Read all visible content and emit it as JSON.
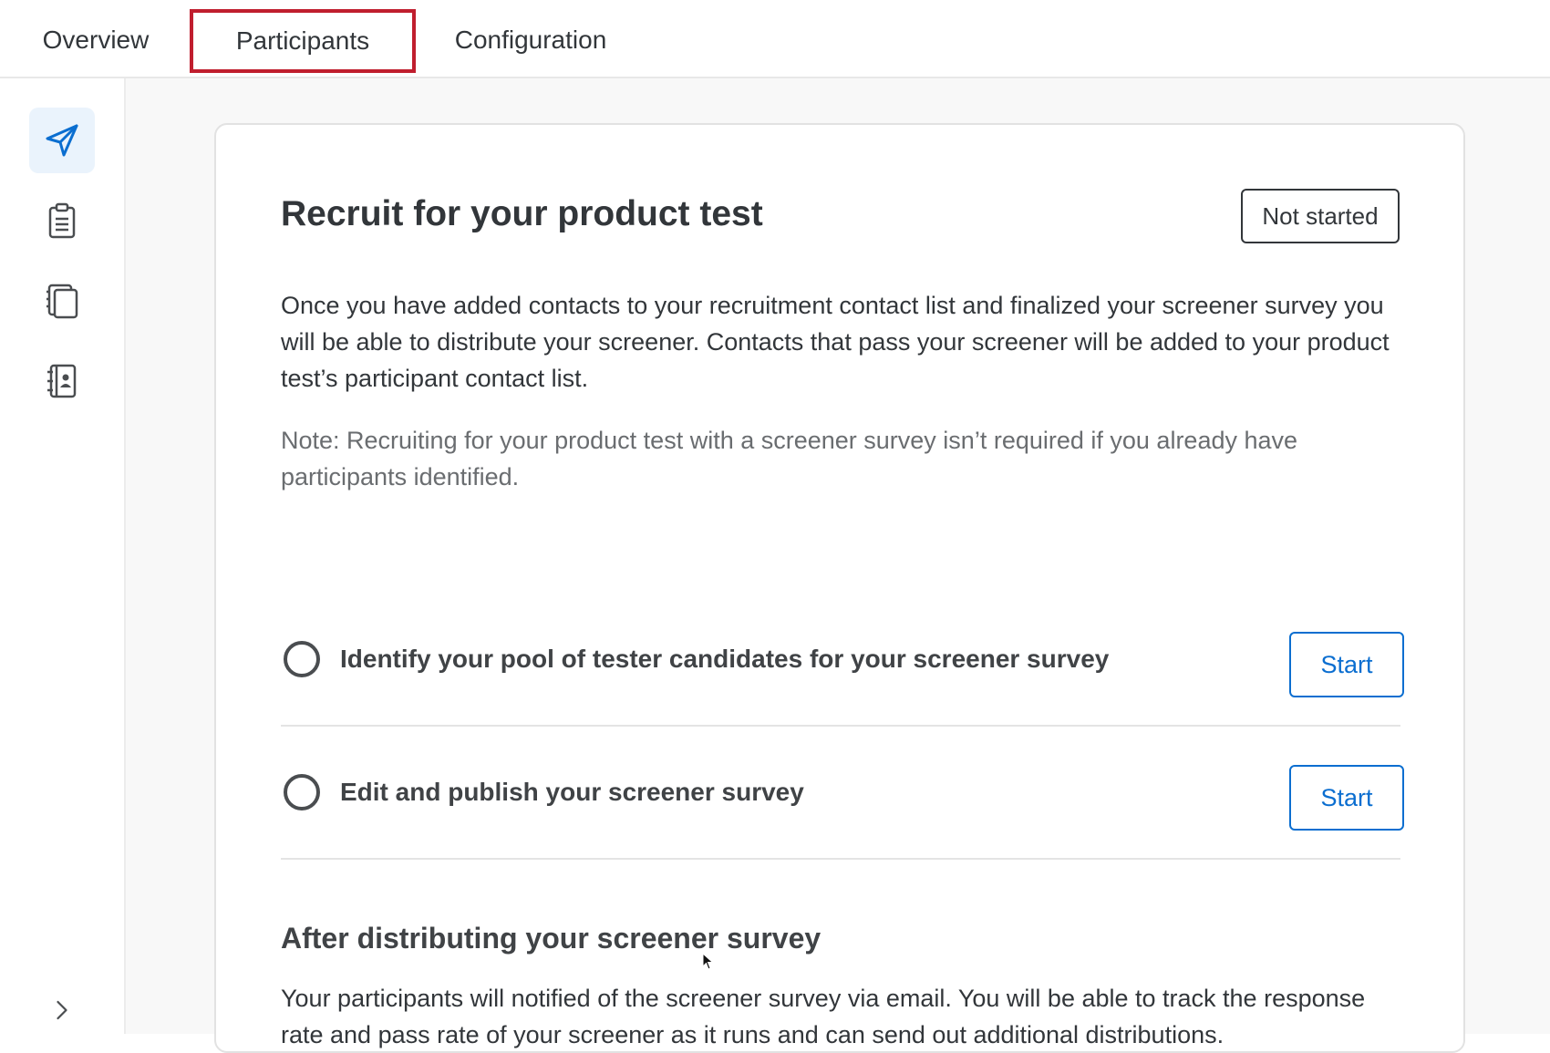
{
  "tabs": {
    "overview": "Overview",
    "participants": "Participants",
    "configuration": "Configuration"
  },
  "sidebar": {
    "items": [
      {
        "icon": "send-icon",
        "active": true
      },
      {
        "icon": "clipboard-icon",
        "active": false
      },
      {
        "icon": "pages-icon",
        "active": false
      },
      {
        "icon": "contact-book-icon",
        "active": false
      }
    ],
    "expand_icon": "chevron-right-icon"
  },
  "card": {
    "title": "Recruit for your product test",
    "status": "Not started",
    "description": "Once you have added contacts to your recruitment contact list and finalized your screener survey you will be able to distribute your screener. Contacts that pass your screener will be added to your product test’s participant contact list.",
    "note": "Note: Recruiting for your product test with a screener survey isn’t required if you already have participants identified.",
    "steps": [
      {
        "label": "Identify your pool of tester candidates for your screener survey",
        "button": "Start"
      },
      {
        "label": "Edit and publish your screener survey",
        "button": "Start"
      }
    ],
    "after_title": "After distributing your screener survey",
    "after_text": "Your participants will notified of the screener survey via email. You will be able to track the response rate and pass rate of your screener as it runs and can send out additional distributions."
  },
  "colors": {
    "accent": "#0b6ed0",
    "highlight": "#c01e2e",
    "active_bg": "#eaf3fc"
  }
}
